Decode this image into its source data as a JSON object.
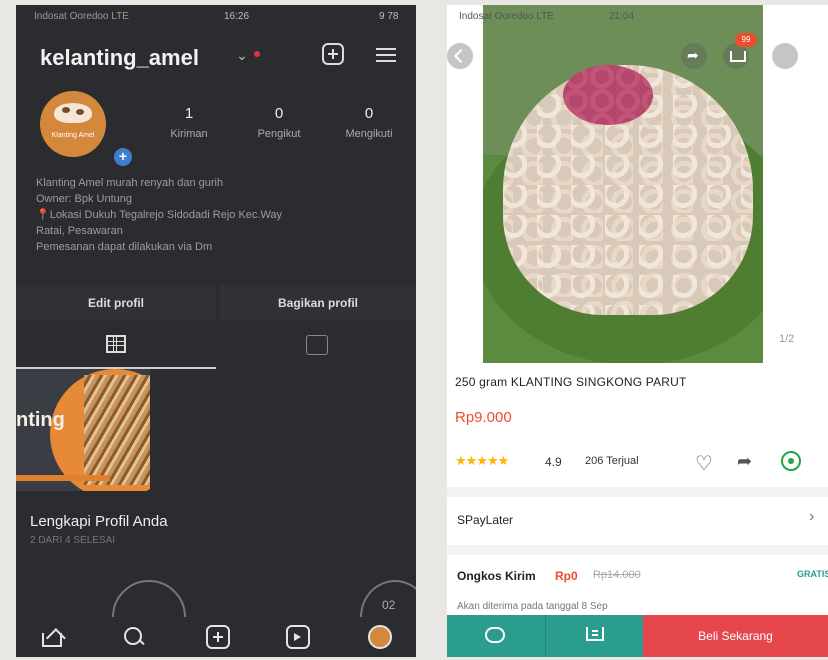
{
  "instagram": {
    "status": {
      "carrier": "Indosat Ooredoo LTE",
      "time": "16:26",
      "battery": "9 78"
    },
    "username": "kelanting_amel",
    "avatar_brand": "Klanting Amel",
    "stats": [
      {
        "num": "1",
        "label": "Kiriman"
      },
      {
        "num": "0",
        "label": "Pengikut"
      },
      {
        "num": "0",
        "label": "Mengikuti"
      }
    ],
    "bio": [
      "Klanting Amel murah renyah dan gurih",
      "Owner: Bpk Untung",
      "📍Lokasi Dukuh Tegalrejo Sidodadi Rejo Kec.Way",
      "Ratai, Pesawaran",
      "Pemesanan dapat dilakukan via Dm"
    ],
    "edit_profile": "Edit profil",
    "share_profile": "Bagikan profil",
    "post_text": "nting",
    "complete_title": "Lengkapi Profil Anda",
    "complete_sub": "2 DARI 4 SELESAI",
    "ring_text": "02"
  },
  "shopee": {
    "status": {
      "carrier": "Indosat Ooredoo LTE",
      "time": "21:04"
    },
    "cart_badge": "99",
    "image_counter": "1/2",
    "title": "250 gram KLANTING SINGKONG PARUT",
    "price": "Rp9.000",
    "stars": "★★★★★",
    "rating": "4.9",
    "sold": "206 Terjual",
    "paylater": "SPayLater",
    "ship_label": "Ongkos Kirim",
    "ship_price": "Rp0",
    "ship_strike": "Rp14.000",
    "ship_badge": "GRATIS",
    "ship_note": "Akan diterima pada tanggal 8 Sep",
    "buy_now": "Beli Sekarang"
  },
  "colors": {
    "shopee_orange": "#ee4d2d",
    "teal": "#2a9d8f",
    "buy_red": "#e6474d",
    "ig_bg": "#2b2c30"
  }
}
